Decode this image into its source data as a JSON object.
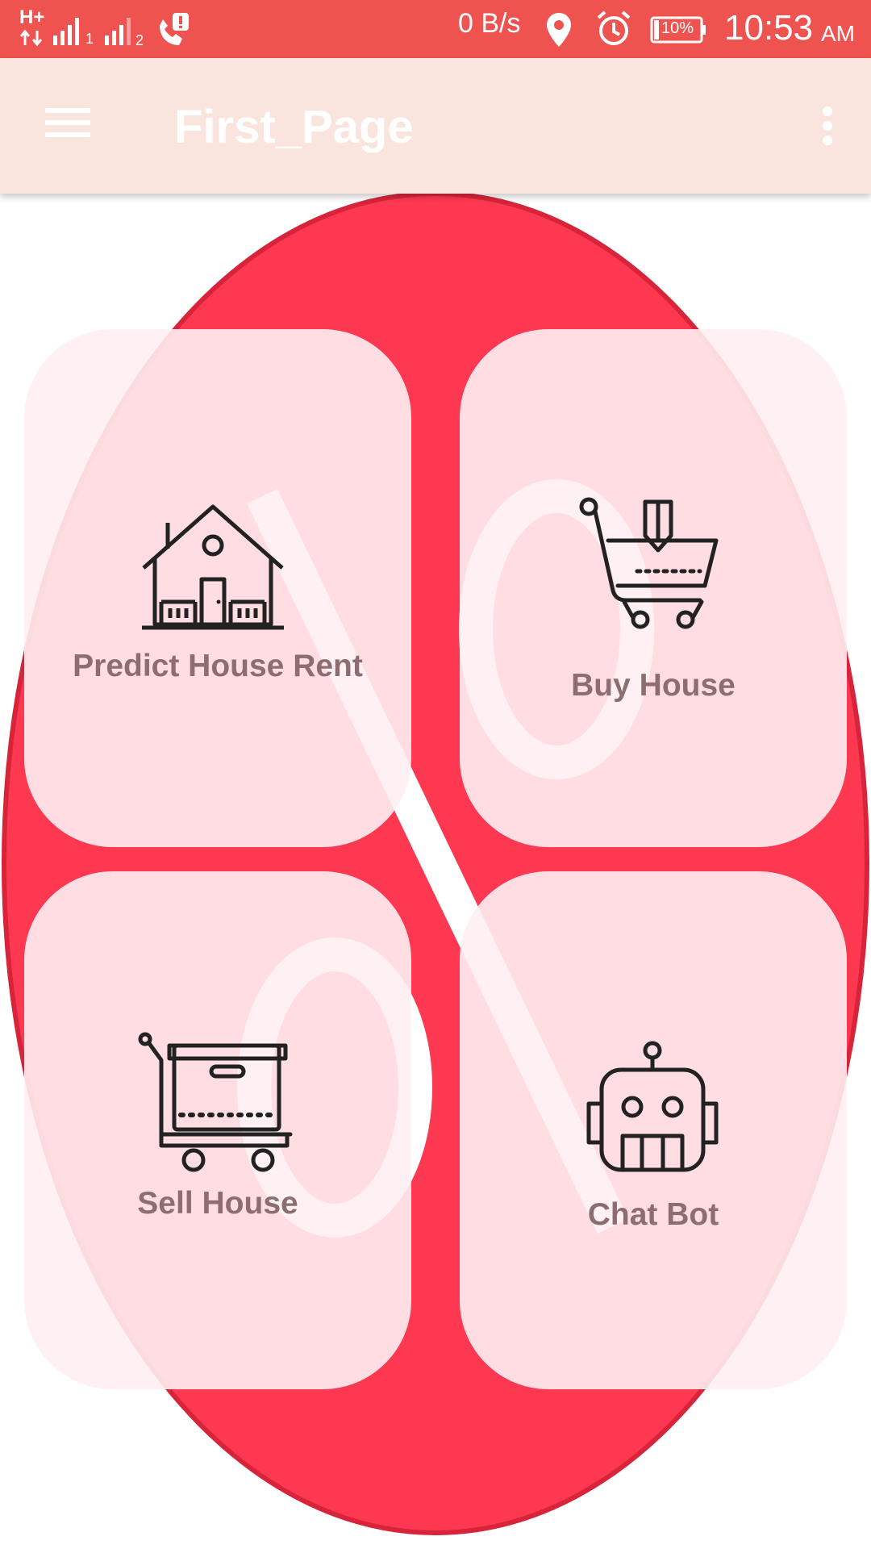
{
  "status_bar": {
    "network": "H+",
    "sim1": "1",
    "sim2": "2",
    "speed": "0 B/s",
    "battery": "10%",
    "time": "10:53",
    "ampm": "AM"
  },
  "app_bar": {
    "title": "First_Page"
  },
  "tiles": [
    {
      "label": "Predict House Rent",
      "icon": "house-icon"
    },
    {
      "label": "Buy House",
      "icon": "cart-download-icon"
    },
    {
      "label": "Sell House",
      "icon": "trolley-box-icon"
    },
    {
      "label": "Chat Bot",
      "icon": "robot-icon"
    }
  ],
  "colors": {
    "status_bar": "#ef5350",
    "app_bar": "#fae5de",
    "accent_red": "#fe3851",
    "tile_bg": "#ffeef0",
    "label_text": "#8c6e70"
  }
}
